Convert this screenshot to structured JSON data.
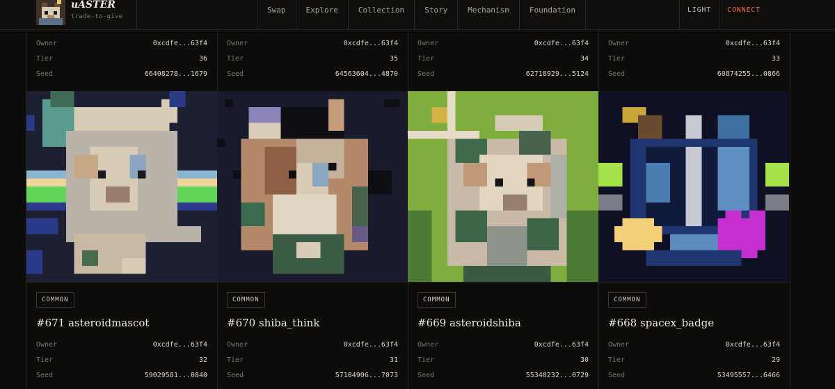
{
  "header": {
    "brand_name": "uASTER",
    "brand_tagline": "trade-to-give",
    "logo_icon": "cat-mascot-pixel-logo",
    "nav": [
      "Swap",
      "Explore",
      "Collection",
      "Story",
      "Mechanism",
      "Foundation"
    ],
    "theme_label": "LIGHT",
    "connect_label": "CONNECT"
  },
  "labels": {
    "owner": "Owner",
    "tier": "Tier",
    "seed": "Seed"
  },
  "colors": {
    "accent": "#ef6b4c",
    "background": "#0d0c0a"
  },
  "cards": [
    {
      "top_owner": "0xcdfe...63f4",
      "top_tier": "36",
      "top_seed": "66408278...1679",
      "rarity": "COMMON",
      "title": "#671 asteroidmascot",
      "owner": "0xcdfe...63f4",
      "tier": "32",
      "seed": "59029581...0840",
      "art": "asteroidmascot pixel cat with blue-green stripes"
    },
    {
      "top_owner": "0xcdfe...63f4",
      "top_tier": "35",
      "top_seed": "64563604...4870",
      "rarity": "COMMON",
      "title": "#670 shiba_think",
      "owner": "0xcdfe...63f4",
      "tier": "31",
      "seed": "57184906...7073",
      "art": "shiba_think pixel dog on dark background"
    },
    {
      "top_owner": "0xcdfe...63f4",
      "top_tier": "34",
      "top_seed": "62718929...5124",
      "rarity": "COMMON",
      "title": "#669 asteroidshiba",
      "owner": "0xcdfe...63f4",
      "tier": "30",
      "seed": "55340232...0729",
      "art": "asteroidshiba pixel dog on green background"
    },
    {
      "top_owner": "0xcdfe...63f4",
      "top_tier": "33",
      "top_seed": "60874255...0866",
      "rarity": "COMMON",
      "title": "#668 spacex_badge",
      "owner": "0xcdfe...63f4",
      "tier": "29",
      "seed": "53495557...6466",
      "art": "spacex_badge pixel badge with blue ring and magenta heart"
    }
  ]
}
